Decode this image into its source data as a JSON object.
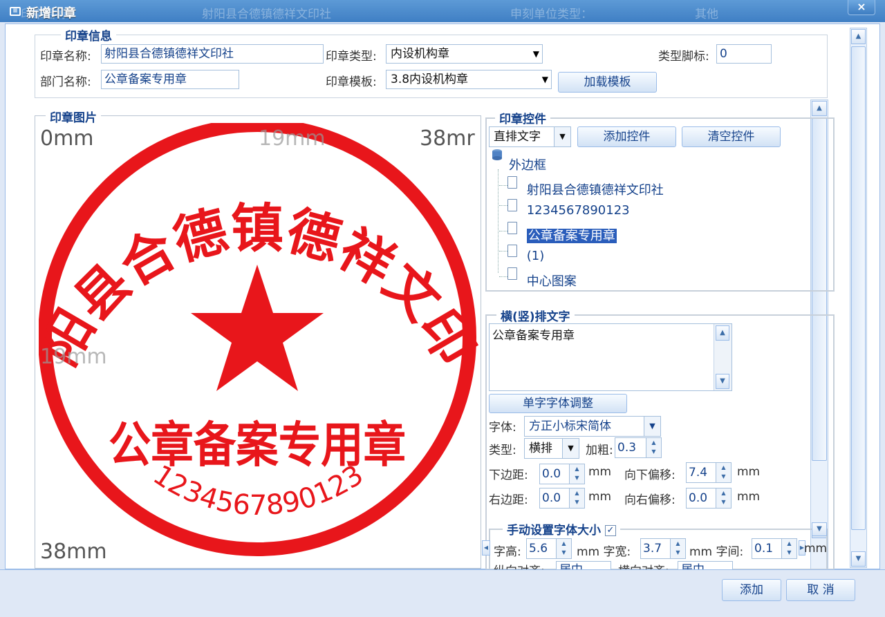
{
  "background_form": {
    "label1": "印章名称：",
    "value1": "射阳县合德镇德祥文印社",
    "label2": "申刻单位类型：",
    "value2": "其他"
  },
  "window": {
    "title": "新增印章",
    "close": "×"
  },
  "seal_info": {
    "legend": "印章信息",
    "name_label": "印章名称:",
    "name_value": "射阳县合德镇德祥文印社",
    "type_label": "印章类型:",
    "type_value": "内设机构章",
    "footnote_label": "类型脚标:",
    "footnote_value": "0",
    "dept_label": "部门名称:",
    "dept_value": "公章备案专用章",
    "template_label": "印章模板:",
    "template_value": "3.8内设机构章",
    "load_template": "加载模板"
  },
  "seal_image": {
    "legend": "印章图片",
    "ruler": {
      "top_left": "0mm",
      "top_mid": "19mm",
      "top_right": "38mr",
      "mid_left": "19mm",
      "bottom_left": "38mm"
    },
    "seal": {
      "arc_text": "射阳县合德镇德祥文印社",
      "center_text": "公章备案专用章",
      "number_text": "1234567890123",
      "color": "#e8161b"
    }
  },
  "controls": {
    "legend": "印章控件",
    "mode_value": "直排文字",
    "add_label": "添加控件",
    "clear_label": "清空控件",
    "tree": {
      "root": "外边框",
      "children": [
        "射阳县合德镇德祥文印社",
        "1234567890123",
        "公章备案专用章",
        "(1)",
        "中心图案"
      ],
      "selected_index": 2
    }
  },
  "text_props": {
    "legend": "横(竖)排文字",
    "text_value": "公章备案专用章",
    "adjust_label": "单字字体调整",
    "font_label": "字体:",
    "font_value": "方正小标宋简体",
    "type_label": "类型:",
    "type_value": "横排",
    "bold_label": "加粗:",
    "bold_value": "0.3",
    "bottom_margin_label": "下边距:",
    "bottom_margin_value": "0.0",
    "down_offset_label": "向下偏移:",
    "down_offset_value": "7.4",
    "right_margin_label": "右边距:",
    "right_margin_value": "0.0",
    "right_offset_label": "向右偏移:",
    "right_offset_value": "0.0",
    "unit": "mm"
  },
  "manual_font": {
    "legend": "手动设置字体大小",
    "checked": true,
    "height_label": "字高:",
    "height_value": "5.6",
    "width_label": "mm 字宽:",
    "width_value": "3.7",
    "spacing_label": "mm 字间:",
    "spacing_value": "0.1",
    "unit": "mm",
    "valign_label": "纵向对齐:",
    "valign_value": "居中",
    "halign_label": "横向对齐:",
    "halign_value": "居中"
  },
  "footer": {
    "add": "添加",
    "cancel": "取 消"
  }
}
